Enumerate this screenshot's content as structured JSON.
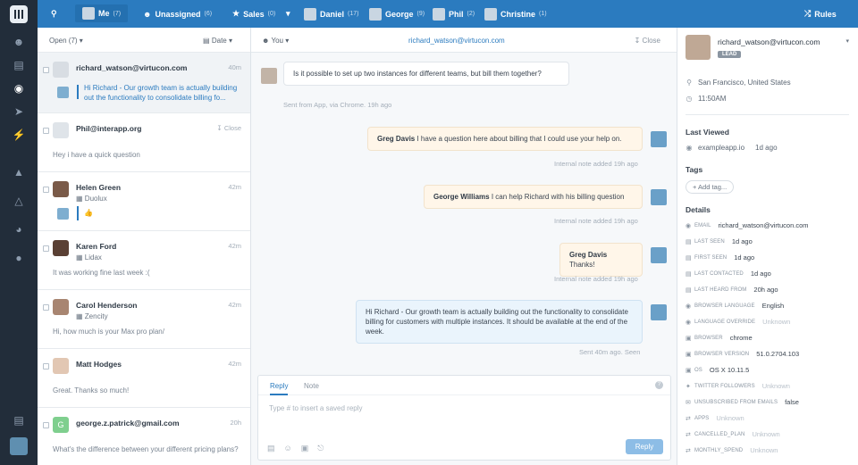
{
  "topbar": {
    "me": {
      "label": "Me",
      "count": "(7)"
    },
    "unassigned": {
      "label": "Unassigned",
      "count": "(6)"
    },
    "sales": {
      "label": "Sales",
      "count": "(0)"
    },
    "team": [
      {
        "label": "Daniel",
        "count": "(17)"
      },
      {
        "label": "George",
        "count": "(9)"
      },
      {
        "label": "Phil",
        "count": "(2)"
      },
      {
        "label": "Christine",
        "count": "(1)"
      }
    ],
    "rules": "Rules"
  },
  "list": {
    "filter": "Open (7)",
    "sort": "Date",
    "conversations": [
      {
        "name": "richard_watson@virtucon.com",
        "time": "40m",
        "preview": "Hi Richard - Our growth team is actually building out the functionality to consolidate billing fo..."
      },
      {
        "name": "Phil@interapp.org",
        "close": "Close",
        "preview": "Hey i have a quick question"
      },
      {
        "name": "Helen Green",
        "time": "42m",
        "company": "Duolux",
        "preview": "👍"
      },
      {
        "name": "Karen Ford",
        "time": "42m",
        "company": "Lidax",
        "preview": "It was working fine last week :("
      },
      {
        "name": "Carol Henderson",
        "time": "42m",
        "company": "Zencity",
        "preview": "Hi, how much is your Max pro plan/"
      },
      {
        "name": "Matt Hodges",
        "time": "42m",
        "preview": "Great. Thanks so much!"
      },
      {
        "name": "george.z.patrick@gmail.com",
        "time": "20h",
        "avatar_letter": "G",
        "preview": "What's the difference between your different pricing plans?"
      }
    ]
  },
  "conversation": {
    "assignee": "You",
    "email": "richard_watson@virtucon.com",
    "close": "Close",
    "messages": [
      {
        "text": "Is it possible to set up two instances for different teams, but bill them together?",
        "meta": "Sent from App, via Chrome. 19h ago"
      },
      {
        "author": "Greg Davis",
        "text": "I have a question here about billing that I could use your help on.",
        "meta": "Internal note added 19h ago"
      },
      {
        "author": "George Williams",
        "text": "I can help Richard with his billing question",
        "meta": "Internal note added 19h ago"
      },
      {
        "author": "Greg Davis",
        "text": "Thanks!",
        "meta": "Internal note added 19h ago"
      },
      {
        "text": "Hi Richard - Our growth team is actually building out the functionality to consolidate billing for customers with multiple instances. It should be available at the end of the week.",
        "meta": "Sent 40m ago. Seen"
      }
    ],
    "composer": {
      "tab_reply": "Reply",
      "tab_note": "Note",
      "placeholder": "Type # to insert a saved reply",
      "send": "Reply"
    }
  },
  "profile": {
    "name": "richard_watson@virtucon.com",
    "badge": "LEAD",
    "location": "San Francisco, United States",
    "time": "11:50AM",
    "last_viewed_title": "Last Viewed",
    "last_viewed_site": "exampleapp.io",
    "last_viewed_time": "1d ago",
    "tags_title": "Tags",
    "add_tag": "+ Add tag...",
    "details_title": "Details",
    "details": [
      {
        "key": "Email",
        "value": "richard_watson@virtucon.com"
      },
      {
        "key": "Last seen",
        "value": "1d ago"
      },
      {
        "key": "First seen",
        "value": "1d ago"
      },
      {
        "key": "Last contacted",
        "value": "1d ago"
      },
      {
        "key": "Last heard from",
        "value": "20h ago"
      },
      {
        "key": "Browser language",
        "value": "English"
      },
      {
        "key": "Language override",
        "value": "Unknown"
      },
      {
        "key": "Browser",
        "value": "chrome"
      },
      {
        "key": "Browser version",
        "value": "51.0.2704.103"
      },
      {
        "key": "OS",
        "value": "OS X 10.11.5"
      },
      {
        "key": "Twitter followers",
        "value": "Unknown"
      },
      {
        "key": "Unsubscribed from emails",
        "value": "false"
      },
      {
        "key": "Apps",
        "value": "Unknown"
      },
      {
        "key": "Cancelled_plan",
        "value": "Unknown"
      },
      {
        "key": "Monthly_spend",
        "value": "Unknown"
      }
    ]
  }
}
